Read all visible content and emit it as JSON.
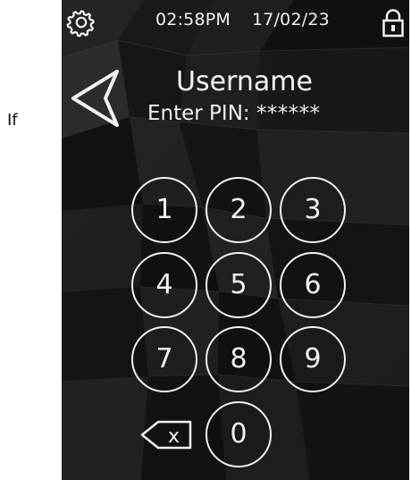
{
  "outside_text": "If",
  "status": {
    "time": "02:58PM",
    "date": "17/02/23"
  },
  "header": {
    "title": "Username",
    "pin_label": "Enter PIN:",
    "pin_value": "******"
  },
  "keypad": {
    "keys": [
      "1",
      "2",
      "3",
      "4",
      "5",
      "6",
      "7",
      "8",
      "9",
      "0"
    ],
    "delete_label": "x"
  },
  "icons": {
    "settings": "gear-icon",
    "lock": "lock-icon",
    "back": "back-arrow-icon",
    "delete": "backspace-icon"
  },
  "colors": {
    "foreground": "#f2f2f2",
    "background": "#151515"
  }
}
